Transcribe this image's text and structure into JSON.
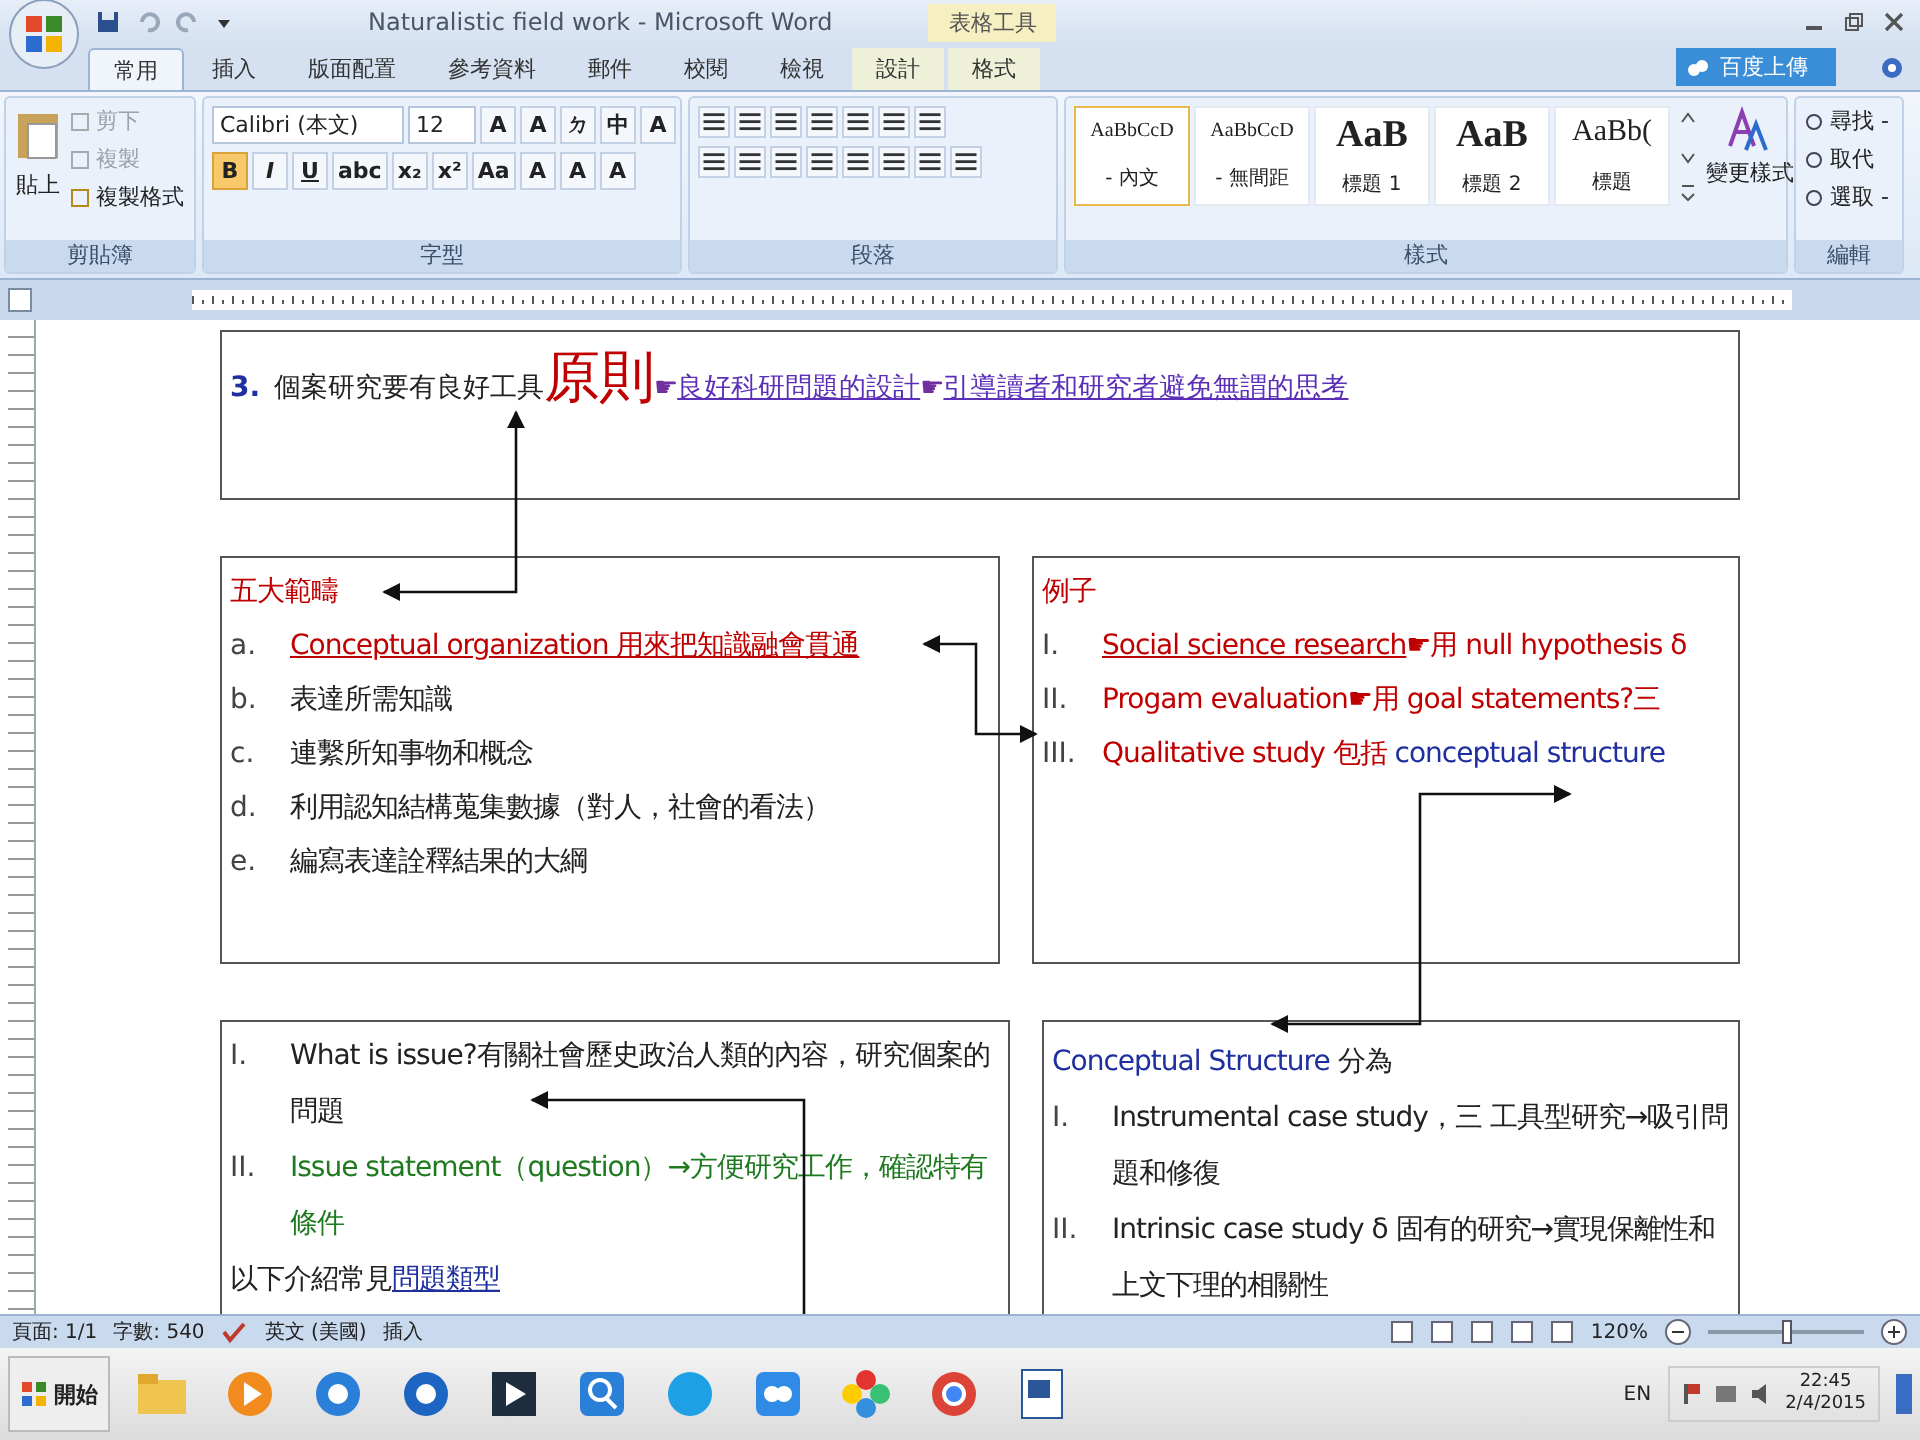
{
  "window": {
    "title": "Naturalistic field work - Microsoft Word",
    "context_tab_group": "表格工具"
  },
  "tabs": [
    {
      "label": "常用",
      "selected": true
    },
    {
      "label": "插入",
      "selected": false
    },
    {
      "label": "版面配置",
      "selected": false
    },
    {
      "label": "參考資料",
      "selected": false
    },
    {
      "label": "郵件",
      "selected": false
    },
    {
      "label": "校閱",
      "selected": false
    },
    {
      "label": "檢視",
      "selected": false
    },
    {
      "label": "設計",
      "selected": false
    },
    {
      "label": "格式",
      "selected": false
    }
  ],
  "upload_button": "百度上傳",
  "ribbon": {
    "clipboard": {
      "label": "剪貼簿",
      "paste": "貼上",
      "items": [
        {
          "label": "剪下",
          "disabled": true
        },
        {
          "label": "複製",
          "disabled": true
        },
        {
          "label": "複製格式",
          "disabled": false
        }
      ]
    },
    "font": {
      "label": "字型",
      "font_name": "Calibri (本文)",
      "font_size": "12",
      "row1": [
        "A",
        "A",
        "ㄉ",
        "中",
        "A"
      ],
      "row2": [
        {
          "label": "B",
          "selected": true
        },
        {
          "label": "I",
          "selected": false
        },
        {
          "label": "U",
          "selected": false
        },
        {
          "label": "abc",
          "selected": false
        },
        {
          "label": "x₂",
          "selected": false
        },
        {
          "label": "x²",
          "selected": false
        },
        {
          "label": "Aa",
          "selected": false
        },
        {
          "label": "A",
          "selected": false
        },
        {
          "label": "A",
          "selected": false
        },
        {
          "label": "A",
          "selected": false
        }
      ]
    },
    "paragraph": {
      "label": "段落"
    },
    "styles": {
      "label": "樣式",
      "items": [
        {
          "sample": "AaBbCcD",
          "name": "- 內文",
          "kind": "normal",
          "selected": true
        },
        {
          "sample": "AaBbCcD",
          "name": "- 無間距",
          "kind": "normal",
          "selected": false
        },
        {
          "sample": "AaB",
          "name": "標題 1",
          "kind": "heading",
          "selected": false
        },
        {
          "sample": "AaB",
          "name": "標題 2",
          "kind": "heading",
          "selected": false
        },
        {
          "sample": "AaBb(",
          "name": "標題",
          "kind": "title",
          "selected": false
        }
      ],
      "change": "變更樣式"
    },
    "editing": {
      "label": "編輯",
      "items": [
        "尋找 -",
        "取代",
        "選取 -"
      ]
    }
  },
  "document": {
    "top_box": {
      "lines": [
        {
          "marker": "3.",
          "parts": [
            {
              "text": "個案研究要有良好工具",
              "color": "#222222"
            },
            {
              "text": "原則",
              "color": "#c00000",
              "big": true
            },
            {
              "text": "☛",
              "color": "#7030a0"
            },
            {
              "text": "良好科研問題的設計",
              "color": "#5b2fb8",
              "underline": true
            },
            {
              "text": "☛",
              "color": "#7030a0"
            },
            {
              "text": "引導讀者和研究者避免無謂的思考",
              "color": "#5b2fb8",
              "underline": true
            }
          ]
        }
      ]
    },
    "left_box": {
      "title": {
        "text": "五大範疇",
        "color": "#c00000"
      },
      "lines": [
        {
          "marker": "a.",
          "parts": [
            {
              "text": "Conceptual organization 用來把知識融會貫通",
              "color": "#c00000",
              "underline": true
            }
          ]
        },
        {
          "marker": "b.",
          "parts": [
            {
              "text": "表達所需知識",
              "color": "#222222"
            }
          ]
        },
        {
          "marker": "c.",
          "parts": [
            {
              "text": "連繫所知事物和概念",
              "color": "#222222"
            }
          ]
        },
        {
          "marker": "d.",
          "parts": [
            {
              "text": "利用認知結構蒐集數據（對人，社會的看法）",
              "color": "#222222"
            }
          ]
        },
        {
          "marker": "e.",
          "parts": [
            {
              "text": "編寫表達詮釋結果的大綱",
              "color": "#222222"
            }
          ]
        }
      ]
    },
    "right_box": {
      "title": {
        "text": "例子",
        "color": "#c00000"
      },
      "lines": [
        {
          "marker": "I.",
          "parts": [
            {
              "text": "Social science research",
              "color": "#c00000",
              "underline": true
            },
            {
              "text": "☛用 null hypothesis δ",
              "color": "#c00000"
            }
          ]
        },
        {
          "marker": "II.",
          "parts": [
            {
              "text": "Progam evaluation☛用 goal statements?三",
              "color": "#c00000"
            }
          ]
        },
        {
          "marker": "III.",
          "parts": [
            {
              "text": "Qualitative study 包括 ",
              "color": "#c00000"
            },
            {
              "text": "conceptual structure",
              "color": "#1f2f9f"
            }
          ]
        }
      ]
    },
    "bottom_left_box": {
      "lines": [
        {
          "marker": "I.",
          "parts": [
            {
              "text": "What is issue?有關社會歷史政治人類的內容，研究個案的問題",
              "color": "#222222"
            }
          ]
        },
        {
          "marker": "II.",
          "parts": [
            {
              "text": "Issue statement（question）→方便研究工作，確認特有條件",
              "color": "#1e7a1e"
            }
          ]
        },
        {
          "parts": [
            {
              "text": "以下介紹常見",
              "color": "#222222"
            },
            {
              "text": "問題類型",
              "color": "#1f2f9f",
              "underline": true
            }
          ]
        }
      ]
    },
    "bottom_right_box": {
      "title_parts": [
        {
          "text": "Conceptual Structure",
          "color": "#1f2f9f"
        },
        {
          "text": " 分為",
          "color": "#222222"
        }
      ],
      "lines": [
        {
          "marker": "I.",
          "parts": [
            {
              "text": "Instrumental case study，三 工具型研究→吸引問題和修復",
              "color": "#222222"
            }
          ]
        },
        {
          "marker": "II.",
          "parts": [
            {
              "text": "Intrinsic case study δ 固有的研究→實現保離性和上文下理的相關性",
              "color": "#222222"
            }
          ]
        }
      ]
    }
  },
  "status_bar": {
    "page": "頁面: 1/1",
    "words": "字數: 540",
    "language": "英文 (美國)",
    "mode": "插入",
    "zoom": "120%",
    "zoom_slider": {
      "level": 0.5
    }
  },
  "taskbar": {
    "start": "開始",
    "language": "EN",
    "time": "22:45",
    "date": "2/4/2015"
  }
}
